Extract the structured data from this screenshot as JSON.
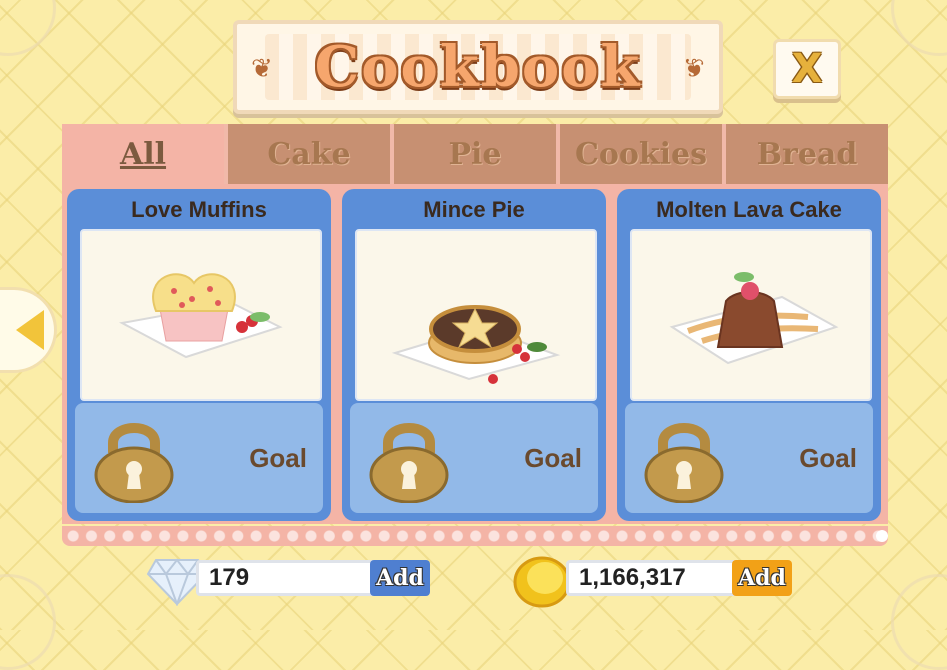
{
  "title": "Cookbook",
  "close_label": "X",
  "tabs": [
    {
      "label": "All",
      "active": true
    },
    {
      "label": "Cake",
      "active": false
    },
    {
      "label": "Pie",
      "active": false
    },
    {
      "label": "Cookies",
      "active": false
    },
    {
      "label": "Bread",
      "active": false
    }
  ],
  "recipes": [
    {
      "name": "Love Muffins",
      "status": "Goal",
      "icon": "love-muffins-icon"
    },
    {
      "name": "Mince Pie",
      "status": "Goal",
      "icon": "mince-pie-icon"
    },
    {
      "name": "Molten Lava Cake",
      "status": "Goal",
      "icon": "molten-lava-cake-icon"
    }
  ],
  "currency": {
    "gems": {
      "value": "179",
      "add_label": "Add",
      "icon": "diamond-icon"
    },
    "coins": {
      "value": "1,166,317",
      "add_label": "Add",
      "icon": "coin-icon"
    }
  },
  "colors": {
    "background": "#fbeda8",
    "panel": "#f4b4a6",
    "card": "#5b8ed8",
    "tab_inactive": "#c79072",
    "gem_add": "#4f7fd0",
    "coin_add": "#f2a117"
  }
}
